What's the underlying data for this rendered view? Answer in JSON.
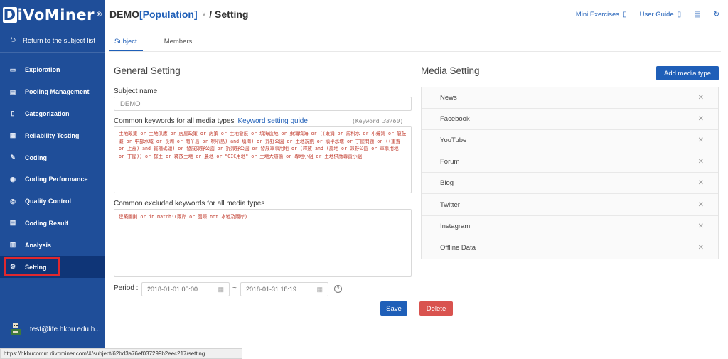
{
  "sidebar": {
    "logo_text": "iVoMiner",
    "logo_box_letter": "D",
    "logo_mark": "®",
    "back_label": "Return to the subject list",
    "items": [
      {
        "label": "Exploration",
        "icon": "monitor-icon",
        "glyph": "▭"
      },
      {
        "label": "Pooling Management",
        "icon": "document-icon",
        "glyph": "▤"
      },
      {
        "label": "Categorization",
        "icon": "file-icon",
        "glyph": "▯"
      },
      {
        "label": "Reliability Testing",
        "icon": "checklist-icon",
        "glyph": "▦"
      },
      {
        "label": "Coding",
        "icon": "pencil-icon",
        "glyph": "✎"
      },
      {
        "label": "Coding Performance",
        "icon": "gauge-icon",
        "glyph": "◉"
      },
      {
        "label": "Quality Control",
        "icon": "eye-icon",
        "glyph": "◎"
      },
      {
        "label": "Coding Result",
        "icon": "report-icon",
        "glyph": "▤"
      },
      {
        "label": "Analysis",
        "icon": "bar-chart-icon",
        "glyph": "▥"
      },
      {
        "label": "Setting",
        "icon": "gear-icon",
        "glyph": "⚙"
      }
    ],
    "user_email": "test@life.hkbu.edu.h..."
  },
  "header": {
    "project": "DEMO",
    "population": "[Population]",
    "page": "/ Setting",
    "mini_exercises": "Mini Exercises",
    "user_guide": "User Guide"
  },
  "tabs": [
    "Subject",
    "Members"
  ],
  "general": {
    "title": "General Setting",
    "subject_name_label": "Subject name",
    "subject_name_value": "DEMO",
    "keywords_label": "Common keywords for all media types",
    "keyword_guide": "Keyword setting guide",
    "keyword_count_prefix": "(Keyword ",
    "keyword_count_value": "38/60",
    "keyword_count_suffix": ")",
    "keywords_text": "土地政策 or 土地供應 or 房屋政策 or 房策 or 土地發展 or 填海造地 or 東涌填海 or ((東涌 or 馬料水 or 小蠔灣 or 龍鼓灘 or 中部水域 or 長洲 or 南丫島 or 喇叭島) and 填海) or 郊野公園 or 土地規劃 or 填平水塘 or 丁屋問題 or ((重置 or 上蓋) and 貨櫃碼頭) or 發展郊野公園 or 拆郊野公園 or 發展軍事用地 or (釋放 and (農地 or 郊野公園 or 軍事用地 or 丁屋)) or 棕土 or 釋放土地 or 農地 or \"GIC用地\" or 土地大辯論 or 專地小組 or 土地供應專責小組",
    "excluded_label": "Common excluded keywords for all media types",
    "excluded_text": "建築圖則 or in.match:(兩岸 or 國際 not 本地及兩岸)",
    "period_label": "Period :",
    "start_date": "2018-01-01 00:00",
    "tilde": "~",
    "end_date": "2018-01-31 18:19",
    "save": "Save",
    "delete": "Delete"
  },
  "media": {
    "title": "Media Setting",
    "add": "Add media type",
    "items": [
      "News",
      "Facebook",
      "YouTube",
      "Forum",
      "Blog",
      "Twitter",
      "Instagram",
      "Offline Data"
    ]
  },
  "status_url": "https://hkbucomm.divominer.com/#/subject/62bd3a76ef037299b2eec217/setting",
  "colors": {
    "sidebar": "#1f4e99",
    "accent": "#1f5fb8",
    "delete": "#d9534f",
    "active_outline": "#e0282e"
  }
}
